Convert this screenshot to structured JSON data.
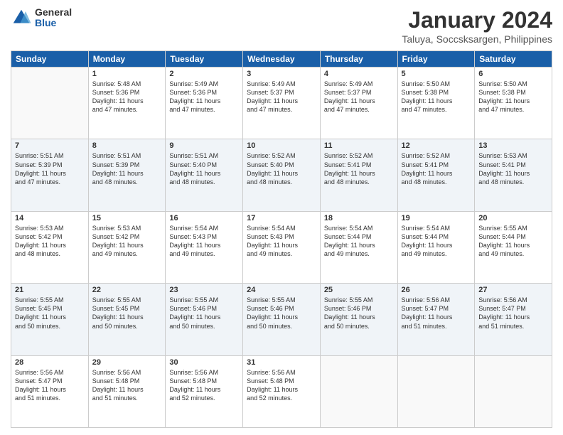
{
  "logo": {
    "general": "General",
    "blue": "Blue"
  },
  "header": {
    "title": "January 2024",
    "subtitle": "Taluya, Soccsksargen, Philippines"
  },
  "weekdays": [
    "Sunday",
    "Monday",
    "Tuesday",
    "Wednesday",
    "Thursday",
    "Friday",
    "Saturday"
  ],
  "weeks": [
    [
      {
        "day": "",
        "info": ""
      },
      {
        "day": "1",
        "info": "Sunrise: 5:48 AM\nSunset: 5:36 PM\nDaylight: 11 hours\nand 47 minutes."
      },
      {
        "day": "2",
        "info": "Sunrise: 5:49 AM\nSunset: 5:36 PM\nDaylight: 11 hours\nand 47 minutes."
      },
      {
        "day": "3",
        "info": "Sunrise: 5:49 AM\nSunset: 5:37 PM\nDaylight: 11 hours\nand 47 minutes."
      },
      {
        "day": "4",
        "info": "Sunrise: 5:49 AM\nSunset: 5:37 PM\nDaylight: 11 hours\nand 47 minutes."
      },
      {
        "day": "5",
        "info": "Sunrise: 5:50 AM\nSunset: 5:38 PM\nDaylight: 11 hours\nand 47 minutes."
      },
      {
        "day": "6",
        "info": "Sunrise: 5:50 AM\nSunset: 5:38 PM\nDaylight: 11 hours\nand 47 minutes."
      }
    ],
    [
      {
        "day": "7",
        "info": "Sunrise: 5:51 AM\nSunset: 5:39 PM\nDaylight: 11 hours\nand 47 minutes."
      },
      {
        "day": "8",
        "info": "Sunrise: 5:51 AM\nSunset: 5:39 PM\nDaylight: 11 hours\nand 48 minutes."
      },
      {
        "day": "9",
        "info": "Sunrise: 5:51 AM\nSunset: 5:40 PM\nDaylight: 11 hours\nand 48 minutes."
      },
      {
        "day": "10",
        "info": "Sunrise: 5:52 AM\nSunset: 5:40 PM\nDaylight: 11 hours\nand 48 minutes."
      },
      {
        "day": "11",
        "info": "Sunrise: 5:52 AM\nSunset: 5:41 PM\nDaylight: 11 hours\nand 48 minutes."
      },
      {
        "day": "12",
        "info": "Sunrise: 5:52 AM\nSunset: 5:41 PM\nDaylight: 11 hours\nand 48 minutes."
      },
      {
        "day": "13",
        "info": "Sunrise: 5:53 AM\nSunset: 5:41 PM\nDaylight: 11 hours\nand 48 minutes."
      }
    ],
    [
      {
        "day": "14",
        "info": "Sunrise: 5:53 AM\nSunset: 5:42 PM\nDaylight: 11 hours\nand 48 minutes."
      },
      {
        "day": "15",
        "info": "Sunrise: 5:53 AM\nSunset: 5:42 PM\nDaylight: 11 hours\nand 49 minutes."
      },
      {
        "day": "16",
        "info": "Sunrise: 5:54 AM\nSunset: 5:43 PM\nDaylight: 11 hours\nand 49 minutes."
      },
      {
        "day": "17",
        "info": "Sunrise: 5:54 AM\nSunset: 5:43 PM\nDaylight: 11 hours\nand 49 minutes."
      },
      {
        "day": "18",
        "info": "Sunrise: 5:54 AM\nSunset: 5:44 PM\nDaylight: 11 hours\nand 49 minutes."
      },
      {
        "day": "19",
        "info": "Sunrise: 5:54 AM\nSunset: 5:44 PM\nDaylight: 11 hours\nand 49 minutes."
      },
      {
        "day": "20",
        "info": "Sunrise: 5:55 AM\nSunset: 5:44 PM\nDaylight: 11 hours\nand 49 minutes."
      }
    ],
    [
      {
        "day": "21",
        "info": "Sunrise: 5:55 AM\nSunset: 5:45 PM\nDaylight: 11 hours\nand 50 minutes."
      },
      {
        "day": "22",
        "info": "Sunrise: 5:55 AM\nSunset: 5:45 PM\nDaylight: 11 hours\nand 50 minutes."
      },
      {
        "day": "23",
        "info": "Sunrise: 5:55 AM\nSunset: 5:46 PM\nDaylight: 11 hours\nand 50 minutes."
      },
      {
        "day": "24",
        "info": "Sunrise: 5:55 AM\nSunset: 5:46 PM\nDaylight: 11 hours\nand 50 minutes."
      },
      {
        "day": "25",
        "info": "Sunrise: 5:55 AM\nSunset: 5:46 PM\nDaylight: 11 hours\nand 50 minutes."
      },
      {
        "day": "26",
        "info": "Sunrise: 5:56 AM\nSunset: 5:47 PM\nDaylight: 11 hours\nand 51 minutes."
      },
      {
        "day": "27",
        "info": "Sunrise: 5:56 AM\nSunset: 5:47 PM\nDaylight: 11 hours\nand 51 minutes."
      }
    ],
    [
      {
        "day": "28",
        "info": "Sunrise: 5:56 AM\nSunset: 5:47 PM\nDaylight: 11 hours\nand 51 minutes."
      },
      {
        "day": "29",
        "info": "Sunrise: 5:56 AM\nSunset: 5:48 PM\nDaylight: 11 hours\nand 51 minutes."
      },
      {
        "day": "30",
        "info": "Sunrise: 5:56 AM\nSunset: 5:48 PM\nDaylight: 11 hours\nand 52 minutes."
      },
      {
        "day": "31",
        "info": "Sunrise: 5:56 AM\nSunset: 5:48 PM\nDaylight: 11 hours\nand 52 minutes."
      },
      {
        "day": "",
        "info": ""
      },
      {
        "day": "",
        "info": ""
      },
      {
        "day": "",
        "info": ""
      }
    ]
  ]
}
